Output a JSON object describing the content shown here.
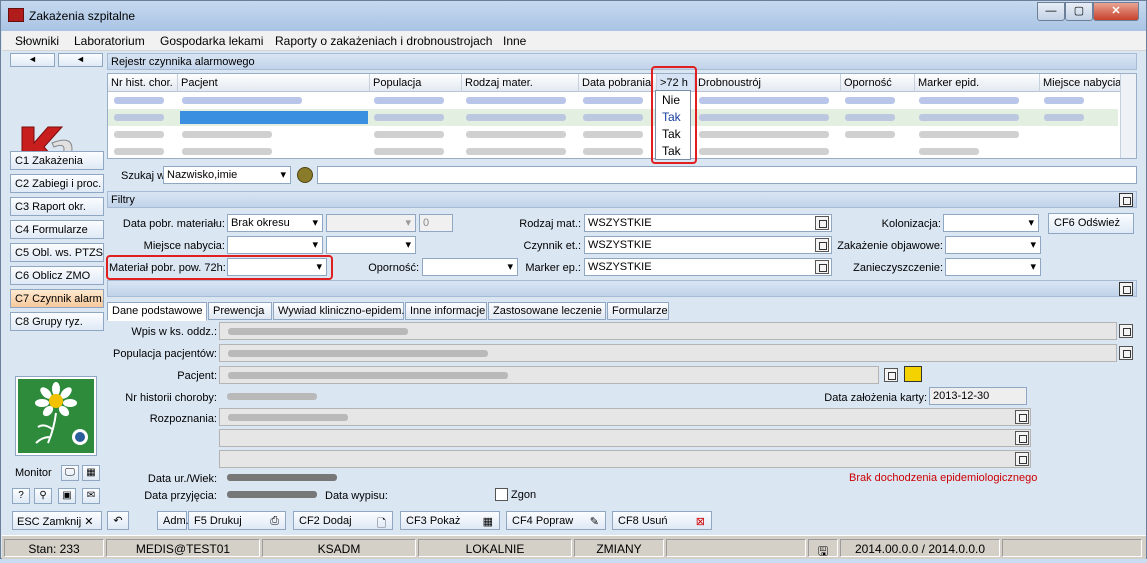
{
  "window": {
    "title": "Zakażenia szpitalne",
    "min": "—",
    "max": "▢",
    "close": "✕"
  },
  "menu": [
    "Słowniki",
    "Laboratorium",
    "Gospodarka lekami",
    "Raporty o zakażeniach i drobnoustrojach",
    "Inne"
  ],
  "left_nav": {
    "arrows": [
      "◄",
      "◄"
    ],
    "items": [
      "C1 Zakażenia",
      "C2 Zabiegi i proc.",
      "C3 Raport okr.",
      "C4 Formularze",
      "C5 Obl. ws. PTZS",
      "C6 Oblicz ZMO",
      "C7 Czynnik alarm.",
      "C8 Grupy ryz."
    ],
    "active_index": 6,
    "monitor_label": "Monitor",
    "exit_label": "ESC Zamknij"
  },
  "registry": {
    "title": "Rejestr czynnika alarmowego",
    "columns": [
      "Nr hist. chor.",
      "Pacjent",
      "Populacja",
      "Rodzaj mater.",
      "Data pobrania",
      ">72 h",
      "Drobnoustrój",
      "Oporność",
      "Marker epid.",
      "Miejsce nabycia"
    ],
    "gt72_values": [
      "Nie",
      "Tak",
      "Tak",
      "Tak"
    ]
  },
  "search": {
    "label": "Szukaj wg:",
    "value": "Nazwisko,imie"
  },
  "filters": {
    "title": "Filtry",
    "data_pobr_label": "Data pobr. materiału:",
    "data_pobr_value": "Brak okresu",
    "days_value": "0",
    "miejsce_label": "Miejsce nabycia:",
    "material72_label": "Materiał pobr. pow. 72h:",
    "opornosc_label": "Oporność:",
    "rodzaj_label": "Rodzaj mat.:",
    "rodzaj_value": "WSZYSTKIE",
    "czynnik_label": "Czynnik et.:",
    "czynnik_value": "WSZYSTKIE",
    "marker_label": "Marker ep.:",
    "marker_value": "WSZYSTKIE",
    "kolonizacja_label": "Kolonizacja:",
    "objawowe_label": "Zakażenie objawowe:",
    "zanieczyszczenie_label": "Zanieczyszczenie:",
    "refresh_label": "CF6 Odśwież"
  },
  "tabs": [
    "Dane podstawowe",
    "Prewencja",
    "Wywiad kliniczno-epidem.",
    "Inne informacje",
    "Zastosowane leczenie",
    "Formularze"
  ],
  "details": {
    "wpis_label": "Wpis w ks. oddz.:",
    "populacja_label": "Populacja pacjentów:",
    "pacjent_label": "Pacjent:",
    "nr_hist_label": "Nr historii choroby:",
    "data_zal_label": "Data założenia karty:",
    "data_zal_value": "2013-12-30",
    "rozpoznania_label": "Rozpoznania:",
    "data_ur_label": "Data ur./Wiek:",
    "data_przyj_label": "Data przyjęcia:",
    "data_wyp_label": "Data wypisu:",
    "zgon_label": "Zgon",
    "warning": "Brak dochodzenia epidemiologicznego"
  },
  "toolbar": {
    "adm": "Adm.",
    "print": "F5 Drukuj",
    "add": "CF2 Dodaj",
    "show": "CF3 Pokaż",
    "edit": "CF4 Popraw",
    "delete": "CF8 Usuń"
  },
  "status": {
    "stan": "Stan: 233",
    "user": "MEDIS@TEST01",
    "ksadm": "KSADM",
    "mode": "LOKALNIE",
    "changes": "ZMIANY",
    "version": "2014.00.0.0 / 2014.0.0.0"
  },
  "colors": {
    "highlight": "#e02020",
    "warning": "#cc0000",
    "accent": "#1a3fa0"
  }
}
